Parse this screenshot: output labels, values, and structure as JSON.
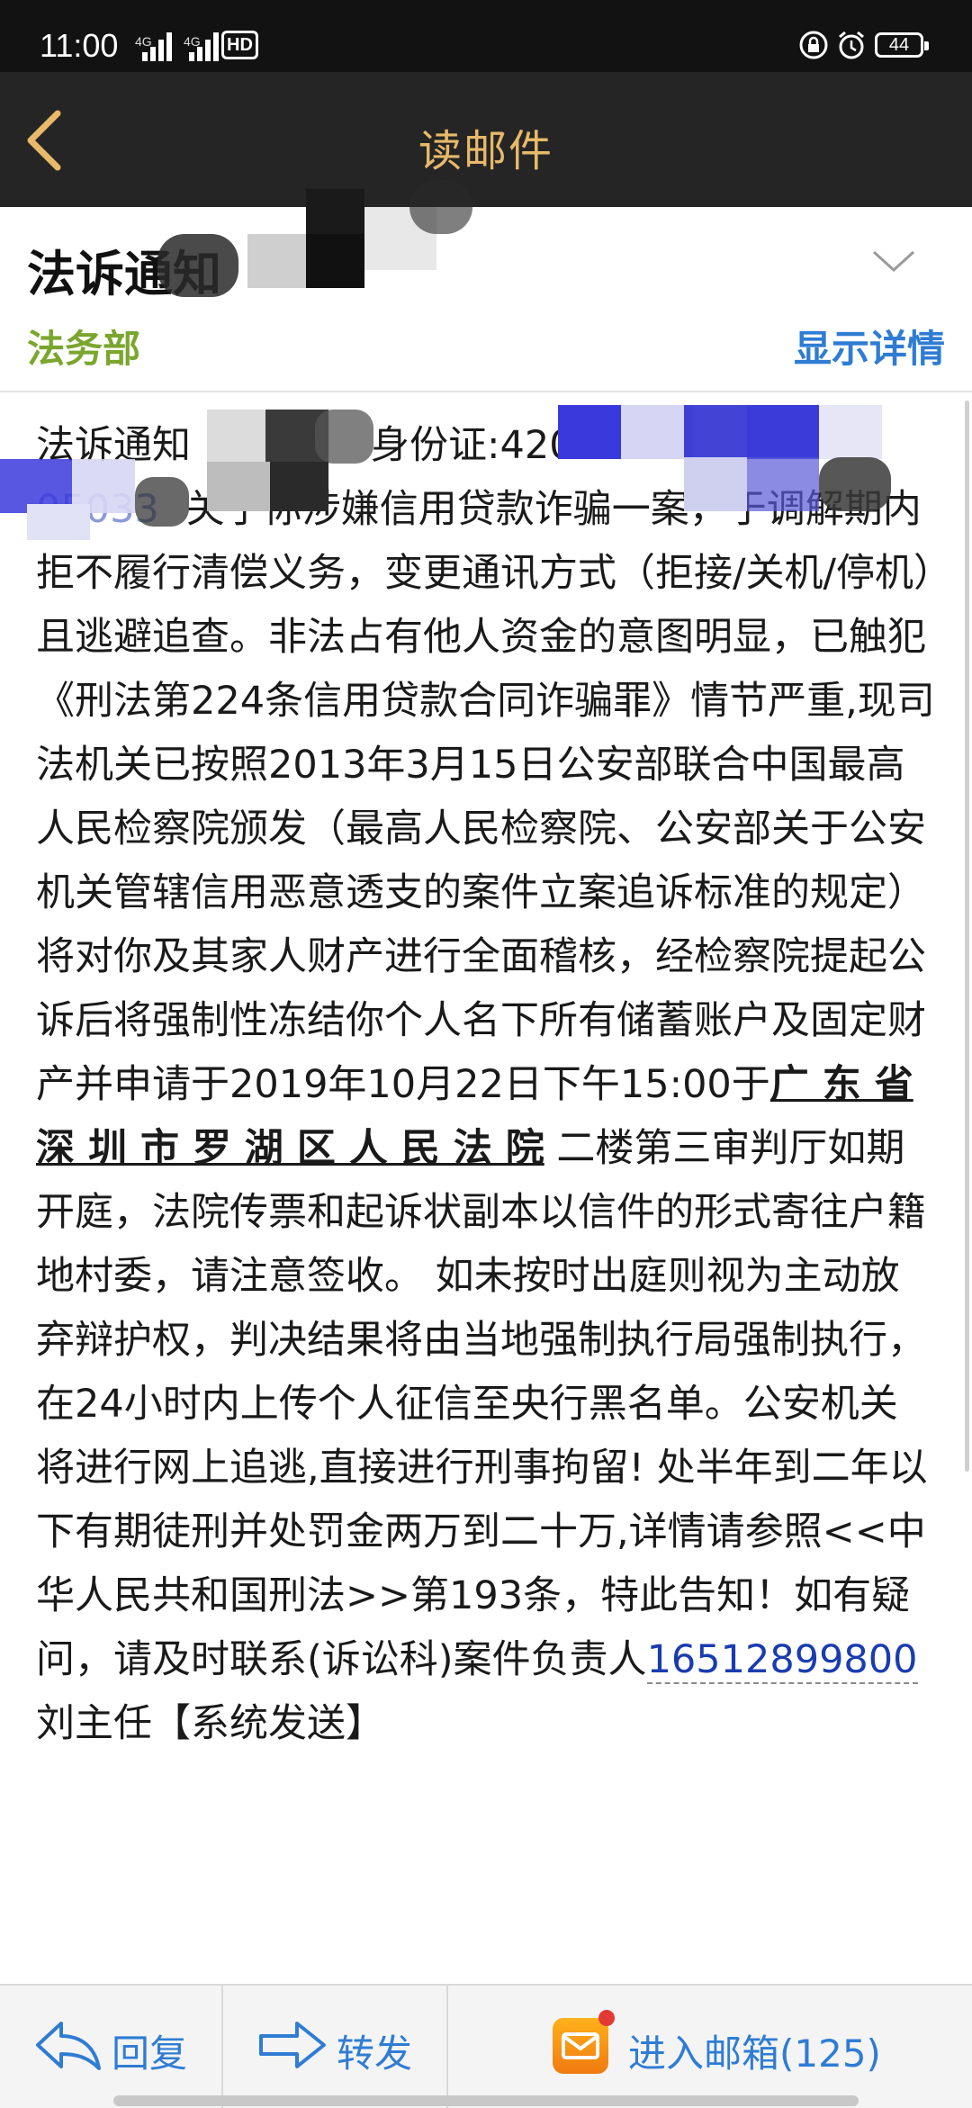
{
  "status_bar": {
    "time": "11:00",
    "signal_1": "4G",
    "signal_2": "4G",
    "hd_label": "HD",
    "battery": "44"
  },
  "nav": {
    "title": "读邮件"
  },
  "header": {
    "subject": "法诉通知",
    "sender": "法务部",
    "show_details": "显示详情"
  },
  "body": {
    "p1": "法诉通知",
    "p2": "身份证:420",
    "p3": "05033",
    "p4": "关于你涉嫌信用贷款诈骗一案，于调解期内拒不履行清偿义务，变更通讯方式（拒接/关机/停机）且逃避追查。非法占有他人资金的意图明显，已触犯《刑法第224条信用贷款合同诈骗罪》情节严重,现司法机关已按照2013年3月15日公安部联合中国最高人民检察院颁发（最高人民检察院、公安部关于公安机关管辖信用恶意透支的案件立案追诉标准的规定）将对你及其家人财产进行全面稽核，经检察院提起公诉后将强制性冻结你个人名下所有储蓄账户及固定财产并申请于2019年10月22日下午15:00于",
    "court": "广 东 省 深 圳 市 罗 湖 区 人 民 法 院",
    "p5": "二楼第三审判厅如期开庭，法院传票和起诉状副本以信件的形式寄往户籍地村委，请注意签收。 如未按时出庭则视为主动放弃辩护权，判决结果将由当地强制执行局强制执行，在24小时内上传个人征信至央行黑名单。公安机关将进行网上追逃,直接进行刑事拘留! 处半年到二年以下有期徒刑并处罚金两万到二十万,详情请参照<<中华人民共和国刑法>>第193条，特此告知！如有疑问，请及时联系(诉讼科)案件负责人",
    "phone": "16512899800",
    "p6": "刘主任【系统发送】"
  },
  "toolbar": {
    "reply": "回复",
    "forward": "转发",
    "inbox": "进入邮箱(125)"
  },
  "colors": {
    "nav_bg": "#252525",
    "nav_title": "#e8b96a",
    "sender": "#7aa62e",
    "link": "#2f7cd3",
    "phone": "#1a3cb0"
  }
}
